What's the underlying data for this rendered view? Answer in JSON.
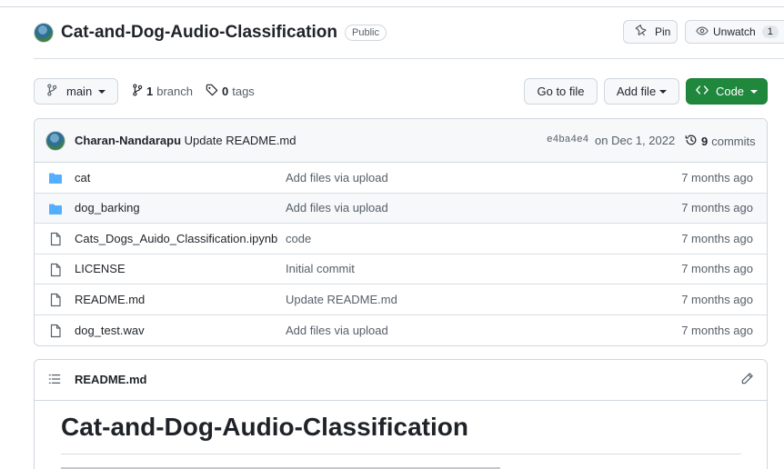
{
  "repo": {
    "name": "Cat-and-Dog-Audio-Classification",
    "visibility": "Public"
  },
  "actions": {
    "pin_label": "Pin",
    "watch_label": "Unwatch",
    "watch_count": "1"
  },
  "branchbar": {
    "branch": "main",
    "branch_count": "1",
    "branch_word": "branch",
    "tag_count": "0",
    "tag_word": "tags",
    "goto_label": "Go to file",
    "addfile_label": "Add file",
    "code_label": "Code"
  },
  "commit": {
    "author": "Charan-Nandarapu",
    "message": "Update README.md",
    "sha": "e4ba4e4",
    "date": "on Dec 1, 2022",
    "count": "9",
    "count_word": "commits"
  },
  "files": [
    {
      "type": "folder",
      "name": "cat",
      "message": "Add files via upload",
      "age": "7 months ago"
    },
    {
      "type": "folder",
      "name": "dog_barking",
      "message": "Add files via upload",
      "age": "7 months ago"
    },
    {
      "type": "file",
      "name": "Cats_Dogs_Auido_Classification.ipynb",
      "message": "code",
      "age": "7 months ago"
    },
    {
      "type": "file",
      "name": "LICENSE",
      "message": "Initial commit",
      "age": "7 months ago"
    },
    {
      "type": "file",
      "name": "README.md",
      "message": "Update README.md",
      "age": "7 months ago"
    },
    {
      "type": "file",
      "name": "dog_test.wav",
      "message": "Add files via upload",
      "age": "7 months ago"
    }
  ],
  "readme": {
    "title": "README.md",
    "heading": "Cat-and-Dog-Audio-Classification"
  },
  "colors": {
    "code_button": "#1f883d",
    "folder_icon": "#54aeff",
    "link_text": "#1f2328",
    "muted_text": "#57606a"
  },
  "icons": [
    "pin-icon",
    "eye-icon",
    "branch-icon",
    "tag-icon",
    "code-icon",
    "history-icon",
    "folder-icon",
    "file-icon",
    "list-icon",
    "pencil-icon"
  ]
}
